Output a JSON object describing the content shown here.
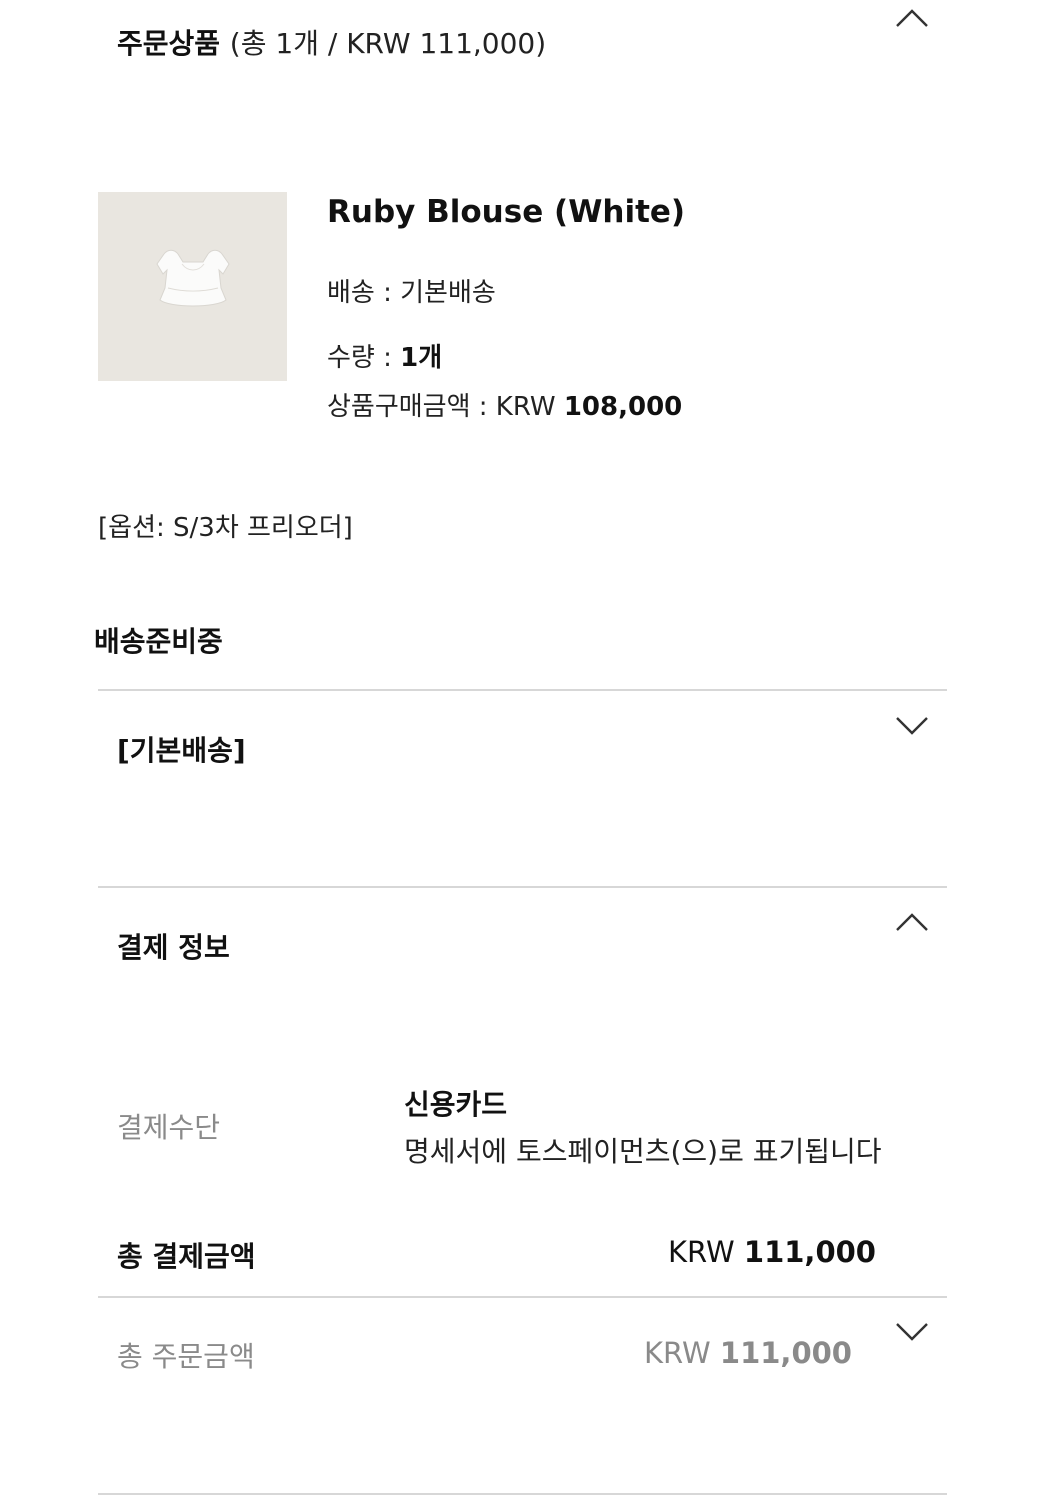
{
  "order_items": {
    "title": "주문상품",
    "summary": "(총 1개 / KRW 111,000)",
    "collapse_icon": "chevron-up-icon"
  },
  "product": {
    "name": "Ruby Blouse (White)",
    "shipping_label": "배송 : ",
    "shipping_value": "기본배송",
    "quantity_label": "수량 : ",
    "quantity_value": "1개",
    "price_label": "상품구매금액 : KRW ",
    "price_value": "108,000",
    "option": "[옵션: S/3차 프리오더]"
  },
  "status": {
    "label": "배송준비중"
  },
  "shipping_group": {
    "title": "[기본배송]",
    "expand_icon": "chevron-down-icon"
  },
  "payment_info": {
    "title": "결제 정보",
    "collapse_icon": "chevron-up-icon",
    "method_label": "결제수단",
    "method_value": "신용카드",
    "method_note": "명세서에 토스페이먼츠(으)로 표기됩니다",
    "total_payment_label": "총 결제금액",
    "total_payment_currency": "KRW ",
    "total_payment_value": "111,000",
    "total_order_label": "총 주문금액",
    "total_order_currency": "KRW ",
    "total_order_value": "111,000",
    "expand_icon": "chevron-down-icon"
  },
  "colors": {
    "text_primary": "#111111",
    "text_secondary": "#8a8a8a",
    "divider": "#d7d7d7",
    "thumbnail_bg": "#e9e6e0"
  }
}
